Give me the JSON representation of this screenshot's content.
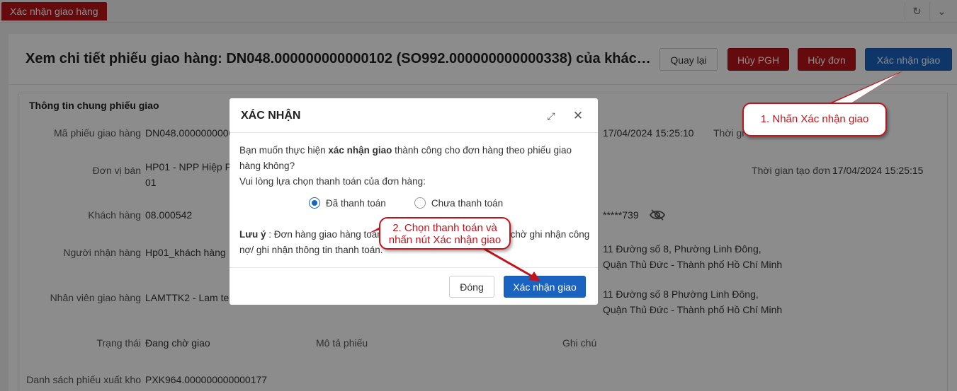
{
  "tabbar": {
    "active_tab": "Xác nhận giao hàng",
    "refresh_icon": "↻",
    "collapse_icon": "⌄"
  },
  "header": {
    "title": "Xem chi tiết phiếu giao hàng: DN048.000000000000102 (SO992.000000000000338) của khác…",
    "back_label": "Quay lại",
    "cancel_pgh_label": "Hủy PGH",
    "cancel_order_label": "Hủy đơn",
    "confirm_label": "Xác nhận giao"
  },
  "section": {
    "title": "Thông tin chung phiếu giao",
    "fields": {
      "ma_phieu_label": "Mã phiếu giao hàng",
      "ma_phieu_value": "DN048.000000000000102",
      "don_vi_label": "Đơn vị bán",
      "don_vi_value_1": "HP01 - NPP Hiệp Phú",
      "don_vi_value_2": "01",
      "khach_hang_label": "Khách hàng",
      "khach_hang_value": "08.000542",
      "nguoi_nhan_label": "Người nhận hàng",
      "nguoi_nhan_value": "Hp01_khách hàng",
      "nhan_vien_label": "Nhân viên giao hàng",
      "nhan_vien_value": "LAMTTK2 - Lam test",
      "trang_thai_label": "Trạng thái",
      "trang_thai_value": "Đang chờ giao",
      "mo_ta_label": "Mô tả phiếu",
      "ghi_chu_label": "Ghi chú",
      "ds_phieu_label": "Danh sách phiếu xuất kho",
      "ds_phieu_value": "PXK964.000000000000177",
      "ngay_value": "17/04/2024 15:25:10",
      "thoi_gian_label_top": "Thời gi",
      "thoi_gian_tao_label": "Thời gian tạo đơn",
      "thoi_gian_tao_value": "17/04/2024 15:25:15",
      "sdt_value": "*****739",
      "dia_chi_1a": "11 Đường số 8, Phường Linh Đông,",
      "dia_chi_1b": "Quận Thủ Đức - Thành phố Hồ Chí Minh",
      "dia_chi_2a": "11 Đường số 8 Phường Linh Đông,",
      "dia_chi_2b": "Quận Thủ Đức - Thành phố Hồ Chí Minh"
    }
  },
  "modal": {
    "title": "XÁC NHẬN",
    "expand_icon": "⤢",
    "close_icon": "✕",
    "line1_pre": "Bạn muốn thực hiện ",
    "line1_bold": "xác nhận giao",
    "line1_post": " thành công cho đơn hàng theo phiếu giao hàng không?",
    "line2": "Vui lòng lựa chọn thanh toán của đơn hàng:",
    "option_paid": "Đã thanh toán",
    "option_unpaid": "Chưa thanh toán",
    "note_label": "Lưu ý",
    "note_text": " : Đơn hàng giao hàng toàn bộ sẽ chuyển sang trạng thái chờ ghi nhận công nợ/ ghi nhận thông tin thanh toán.",
    "close_label": "Đóng",
    "confirm_label": "Xác nhận giao"
  },
  "callouts": {
    "step1": "1. Nhấn Xác nhận giao",
    "step2_line1": "2. Chọn thanh toán và",
    "step2_line2": "nhấn nút Xác nhận giao"
  }
}
